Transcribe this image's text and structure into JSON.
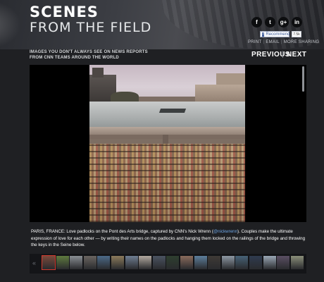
{
  "header": {
    "title_line1": "SCENES",
    "title_line2": "FROM THE FIELD",
    "subtitle_line1": "IMAGES YOU DON'T ALWAYS SEE ON NEWS REPORTS",
    "subtitle_line2": "FROM CNN TEAMS AROUND THE WORLD"
  },
  "social": {
    "facebook_glyph": "f",
    "twitter_glyph": "t",
    "googleplus_glyph": "g+",
    "linkedin_glyph": "in",
    "recommend_label": "Recommend",
    "recommend_count": "7.5k",
    "print_label": "PRINT",
    "email_label": "EMAIL",
    "more_sharing_label": "MORE SHARING"
  },
  "nav": {
    "previous_label": "PREVIOUS",
    "separator": "|",
    "next_label": "NEXT"
  },
  "caption": {
    "text_before_handle": "PARIS, FRANCE: Love padlocks on the Pont des Arts bridge, captured by CNN's Nick Wrenn (",
    "handle": "@nickwrenn",
    "text_after_handle": "). Couples make the ultimate expression of love for each other — by writing their names on the padlocks and hanging them locked on the railings of the bridge and throwing the keys in the Seine below."
  },
  "thumbnails": {
    "left_arrow": "«",
    "right_arrow": "»",
    "colors": [
      "#7a4a3c",
      "#5f7b3f",
      "#8a8f94",
      "#6a6460",
      "#4c6a88",
      "#8c7b5b",
      "#6f7e92",
      "#b2a9a0",
      "#4b5361",
      "#2e3f2f",
      "#8a6b5c",
      "#5d7f9c",
      "#3f3a36",
      "#8d98a3",
      "#476277",
      "#2f3b4f",
      "#9aa7b5",
      "#5a4f63",
      "#8b8f7a"
    ],
    "active_index": 0
  },
  "colors": {
    "accent_active_thumb": "#d23a2e",
    "handle_link": "#6ea6e6",
    "background": "#1f2023"
  }
}
